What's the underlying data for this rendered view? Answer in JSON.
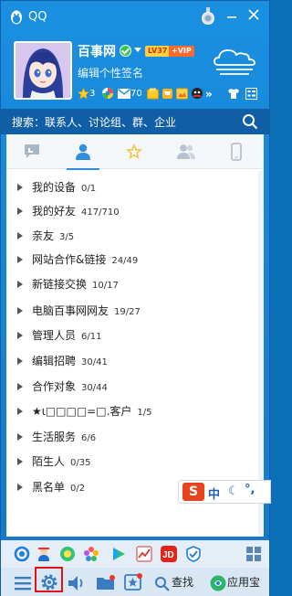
{
  "app": {
    "title": "QQ"
  },
  "profile": {
    "nickname": "百事网",
    "signature": "编辑个性签名",
    "level_badge": "LV37",
    "vip_badge": "+VIP",
    "status": {
      "star_count": "3",
      "mail_count": "70"
    }
  },
  "search": {
    "placeholder": "搜索：联系人、讨论组、群、企业"
  },
  "tabs": [
    "messages",
    "contacts",
    "favorites",
    "groups",
    "phone"
  ],
  "groups": [
    {
      "name": "我的设备",
      "count": "0/1"
    },
    {
      "name": "我的好友",
      "count": "417/710"
    },
    {
      "name": "亲友",
      "count": "3/5"
    },
    {
      "name": "网站合作&链接",
      "count": "24/49"
    },
    {
      "name": "新链接交换",
      "count": "10/17"
    },
    {
      "name": "电脑百事网网友",
      "count": "19/27"
    },
    {
      "name": "管理人员",
      "count": "6/11"
    },
    {
      "name": "编辑招聘",
      "count": "30/41"
    },
    {
      "name": "合作对象",
      "count": "30/44"
    },
    {
      "name": "★ι□□□□=□.客户",
      "count": "1/5"
    },
    {
      "name": "生活服务",
      "count": "6/6"
    },
    {
      "name": "陌生人",
      "count": "0/35"
    },
    {
      "name": "黑名单",
      "count": "0/2"
    }
  ],
  "ime": {
    "logo": "S",
    "lang": "中",
    "moon": "☾",
    "punc": "°,"
  },
  "toolbar": {
    "find_label": "查找",
    "appstore_label": "应用宝"
  },
  "colors": {
    "titlebar": "#1a8fe0",
    "searchbar": "#0f5ea6",
    "highlight": "#e01414"
  }
}
